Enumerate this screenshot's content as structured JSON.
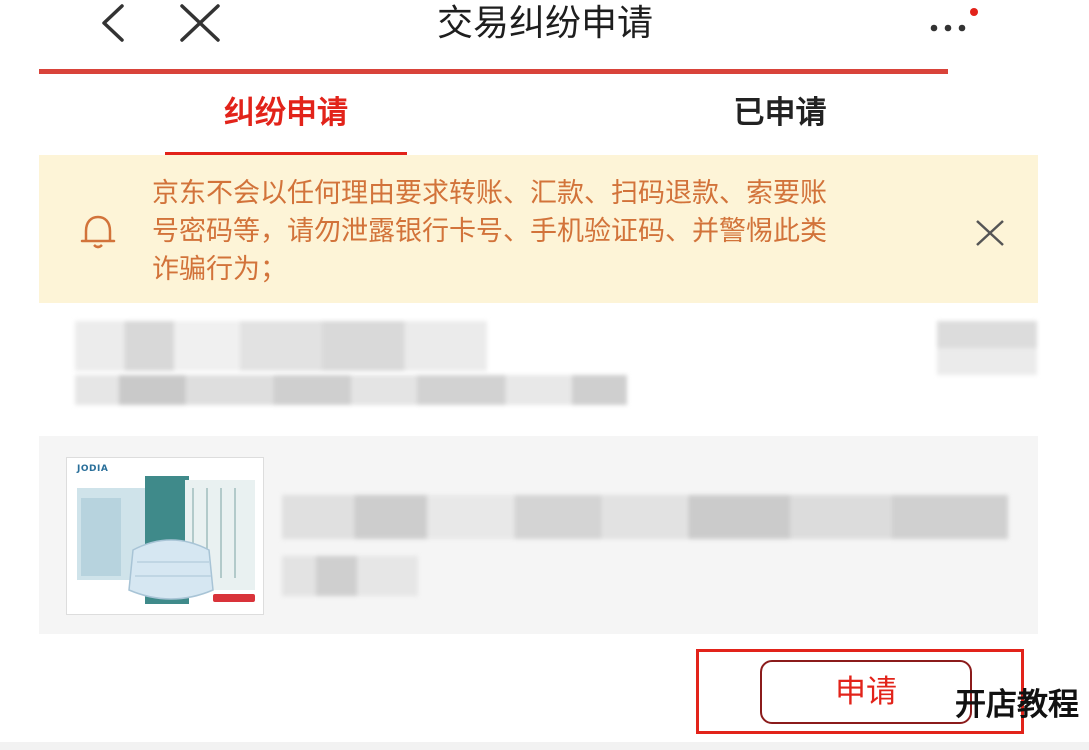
{
  "header": {
    "title": "交易纠纷申请",
    "back_icon": "chevron-left-icon",
    "close_icon": "close-icon",
    "more_icon": "more-horizontal-icon"
  },
  "tabs": [
    {
      "label": "纠纷申请",
      "active": true
    },
    {
      "label": "已申请",
      "active": false
    }
  ],
  "notice": {
    "icon": "bell-icon",
    "text": "京东不会以任何理由要求转账、汇款、扫码退款、索要账\n号密码等，请勿泄露银行卡号、手机验证码、并警惕此类\n诈骗行为；",
    "close_icon": "close-icon"
  },
  "product": {
    "brand": "JODIA"
  },
  "actions": {
    "apply_label": "申请"
  },
  "watermark": "开店教程",
  "colors": {
    "accent": "#e2231a",
    "notice_bg": "#fdf4d7",
    "notice_text": "#d2733a"
  }
}
